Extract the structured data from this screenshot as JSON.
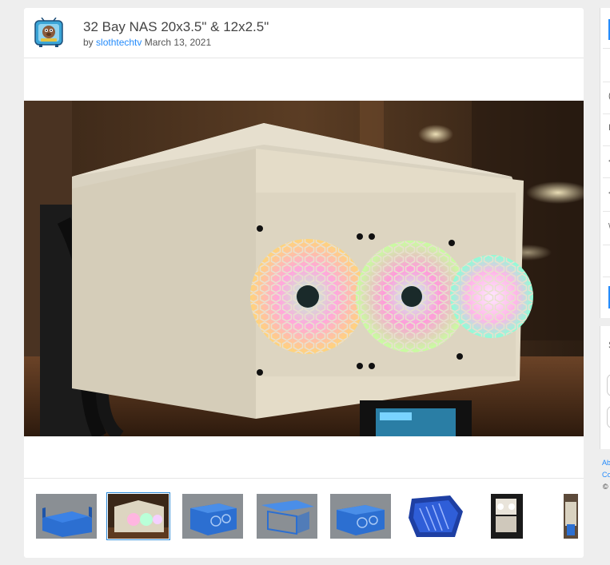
{
  "thing": {
    "title": "32 Bay NAS 20x3.5\" & 12x2.5\"",
    "by_label": "by",
    "author": "slothtechtv",
    "date": "March 13, 2021"
  },
  "thumbnails": [
    {
      "name": "thumb-1",
      "active": false
    },
    {
      "name": "thumb-2",
      "active": true
    },
    {
      "name": "thumb-3",
      "active": false
    },
    {
      "name": "thumb-4",
      "active": false
    },
    {
      "name": "thumb-5",
      "active": false
    },
    {
      "name": "thumb-6",
      "active": false
    },
    {
      "name": "thumb-7",
      "active": false
    },
    {
      "name": "thumb-8",
      "active": false
    }
  ],
  "sidebar": {
    "glyphs": [
      "(",
      "I",
      "<",
      "<",
      "\\"
    ],
    "partial_letter": "S",
    "footer_links": [
      "Ab",
      "Co"
    ],
    "copyright": "©"
  },
  "colors": {
    "link": "#248bfb",
    "title": "#444444",
    "background": "#eeeeee",
    "active_thumb": "#2d8bd8"
  }
}
